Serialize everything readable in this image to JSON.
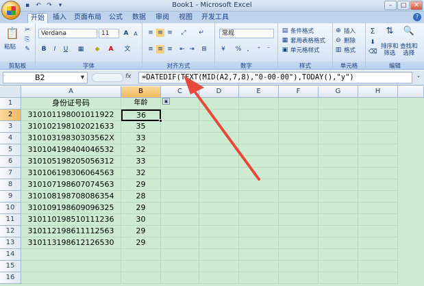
{
  "window": {
    "title": "Book1 - Microsoft Excel",
    "min": "–",
    "max": "□",
    "close": "✕"
  },
  "qat": {
    "save": "▪",
    "undo": "↶",
    "redo": "↷",
    "more": "▾"
  },
  "tabs": [
    "开始",
    "插入",
    "页面布局",
    "公式",
    "数据",
    "审阅",
    "视图",
    "开发工具"
  ],
  "ribbon": {
    "clipboard": {
      "label": "剪贴板",
      "paste": "粘贴",
      "cut": "✂",
      "copy": "⎘",
      "format": "✎"
    },
    "font": {
      "label": "字体",
      "name": "Verdana",
      "size": "11",
      "grow": "A",
      "shrink": "A",
      "bold": "B",
      "italic": "I",
      "underline": "U",
      "wen": "文"
    },
    "align": {
      "label": "对齐方式"
    },
    "number": {
      "label": "数字",
      "format": "常规",
      "percent": "%",
      "comma": ","
    },
    "styles": {
      "label": "样式",
      "cond": "条件格式",
      "table": "套用表格格式",
      "cell": "单元格样式"
    },
    "cells": {
      "label": "单元格",
      "insert": "插入",
      "delete": "删除",
      "format": "格式"
    },
    "edit": {
      "label": "编辑",
      "sum": "Σ",
      "sort": "排序和\n筛选",
      "find": "查找和\n选择"
    }
  },
  "formula_bar": {
    "name_box": "B2",
    "fx": "fx",
    "formula": "=DATEDIF(TEXT(MID(A2,7,8),\"0-00-00\"),TODAY(),\"y\")"
  },
  "sheet": {
    "columns": [
      "A",
      "B",
      "C",
      "D",
      "E",
      "F",
      "G",
      "H"
    ],
    "header_row": {
      "a": "身份证号码",
      "b": "年龄"
    },
    "rows": [
      {
        "a": "310101198001011922",
        "b": "36"
      },
      {
        "a": "310102198102021633",
        "b": "35"
      },
      {
        "a": "31010319830303562X",
        "b": "33"
      },
      {
        "a": "310104198404046532",
        "b": "32"
      },
      {
        "a": "310105198205056312",
        "b": "33"
      },
      {
        "a": "310106198306064563",
        "b": "32"
      },
      {
        "a": "310107198607074563",
        "b": "29"
      },
      {
        "a": "310108198708086354",
        "b": "28"
      },
      {
        "a": "310109198609096325",
        "b": "29"
      },
      {
        "a": "310110198510111236",
        "b": "30"
      },
      {
        "a": "310112198611112563",
        "b": "29"
      },
      {
        "a": "310113198612126530",
        "b": "29"
      }
    ],
    "row_numbers": [
      "1",
      "2",
      "3",
      "4",
      "5",
      "6",
      "7",
      "8",
      "9",
      "10",
      "11",
      "12",
      "13",
      "14",
      "15",
      "16"
    ]
  },
  "colors": {
    "grid_bg": "#ccebd0",
    "arrow": "#e8483a",
    "accent": "#15428b"
  }
}
